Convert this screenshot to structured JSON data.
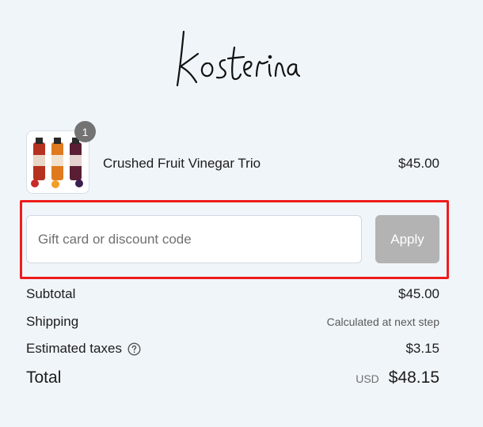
{
  "brand": {
    "logo_text": "kosterina"
  },
  "cart": {
    "item": {
      "name": "Crushed Fruit Vinegar Trio",
      "price": "$45.00",
      "quantity": "1",
      "image_icon": "product-bottles-image"
    }
  },
  "discount": {
    "placeholder": "Gift card or discount code",
    "value": "",
    "apply_label": "Apply"
  },
  "summary": {
    "subtotal_label": "Subtotal",
    "subtotal_value": "$45.00",
    "shipping_label": "Shipping",
    "shipping_value": "Calculated at next step",
    "taxes_label": "Estimated taxes",
    "taxes_value": "$3.15",
    "total_label": "Total",
    "currency": "USD",
    "total_value": "$48.15"
  },
  "colors": {
    "background": "#f0f5fa",
    "highlight": "#ee1c1c",
    "apply_disabled": "#b3b3b3",
    "badge": "#737373"
  }
}
